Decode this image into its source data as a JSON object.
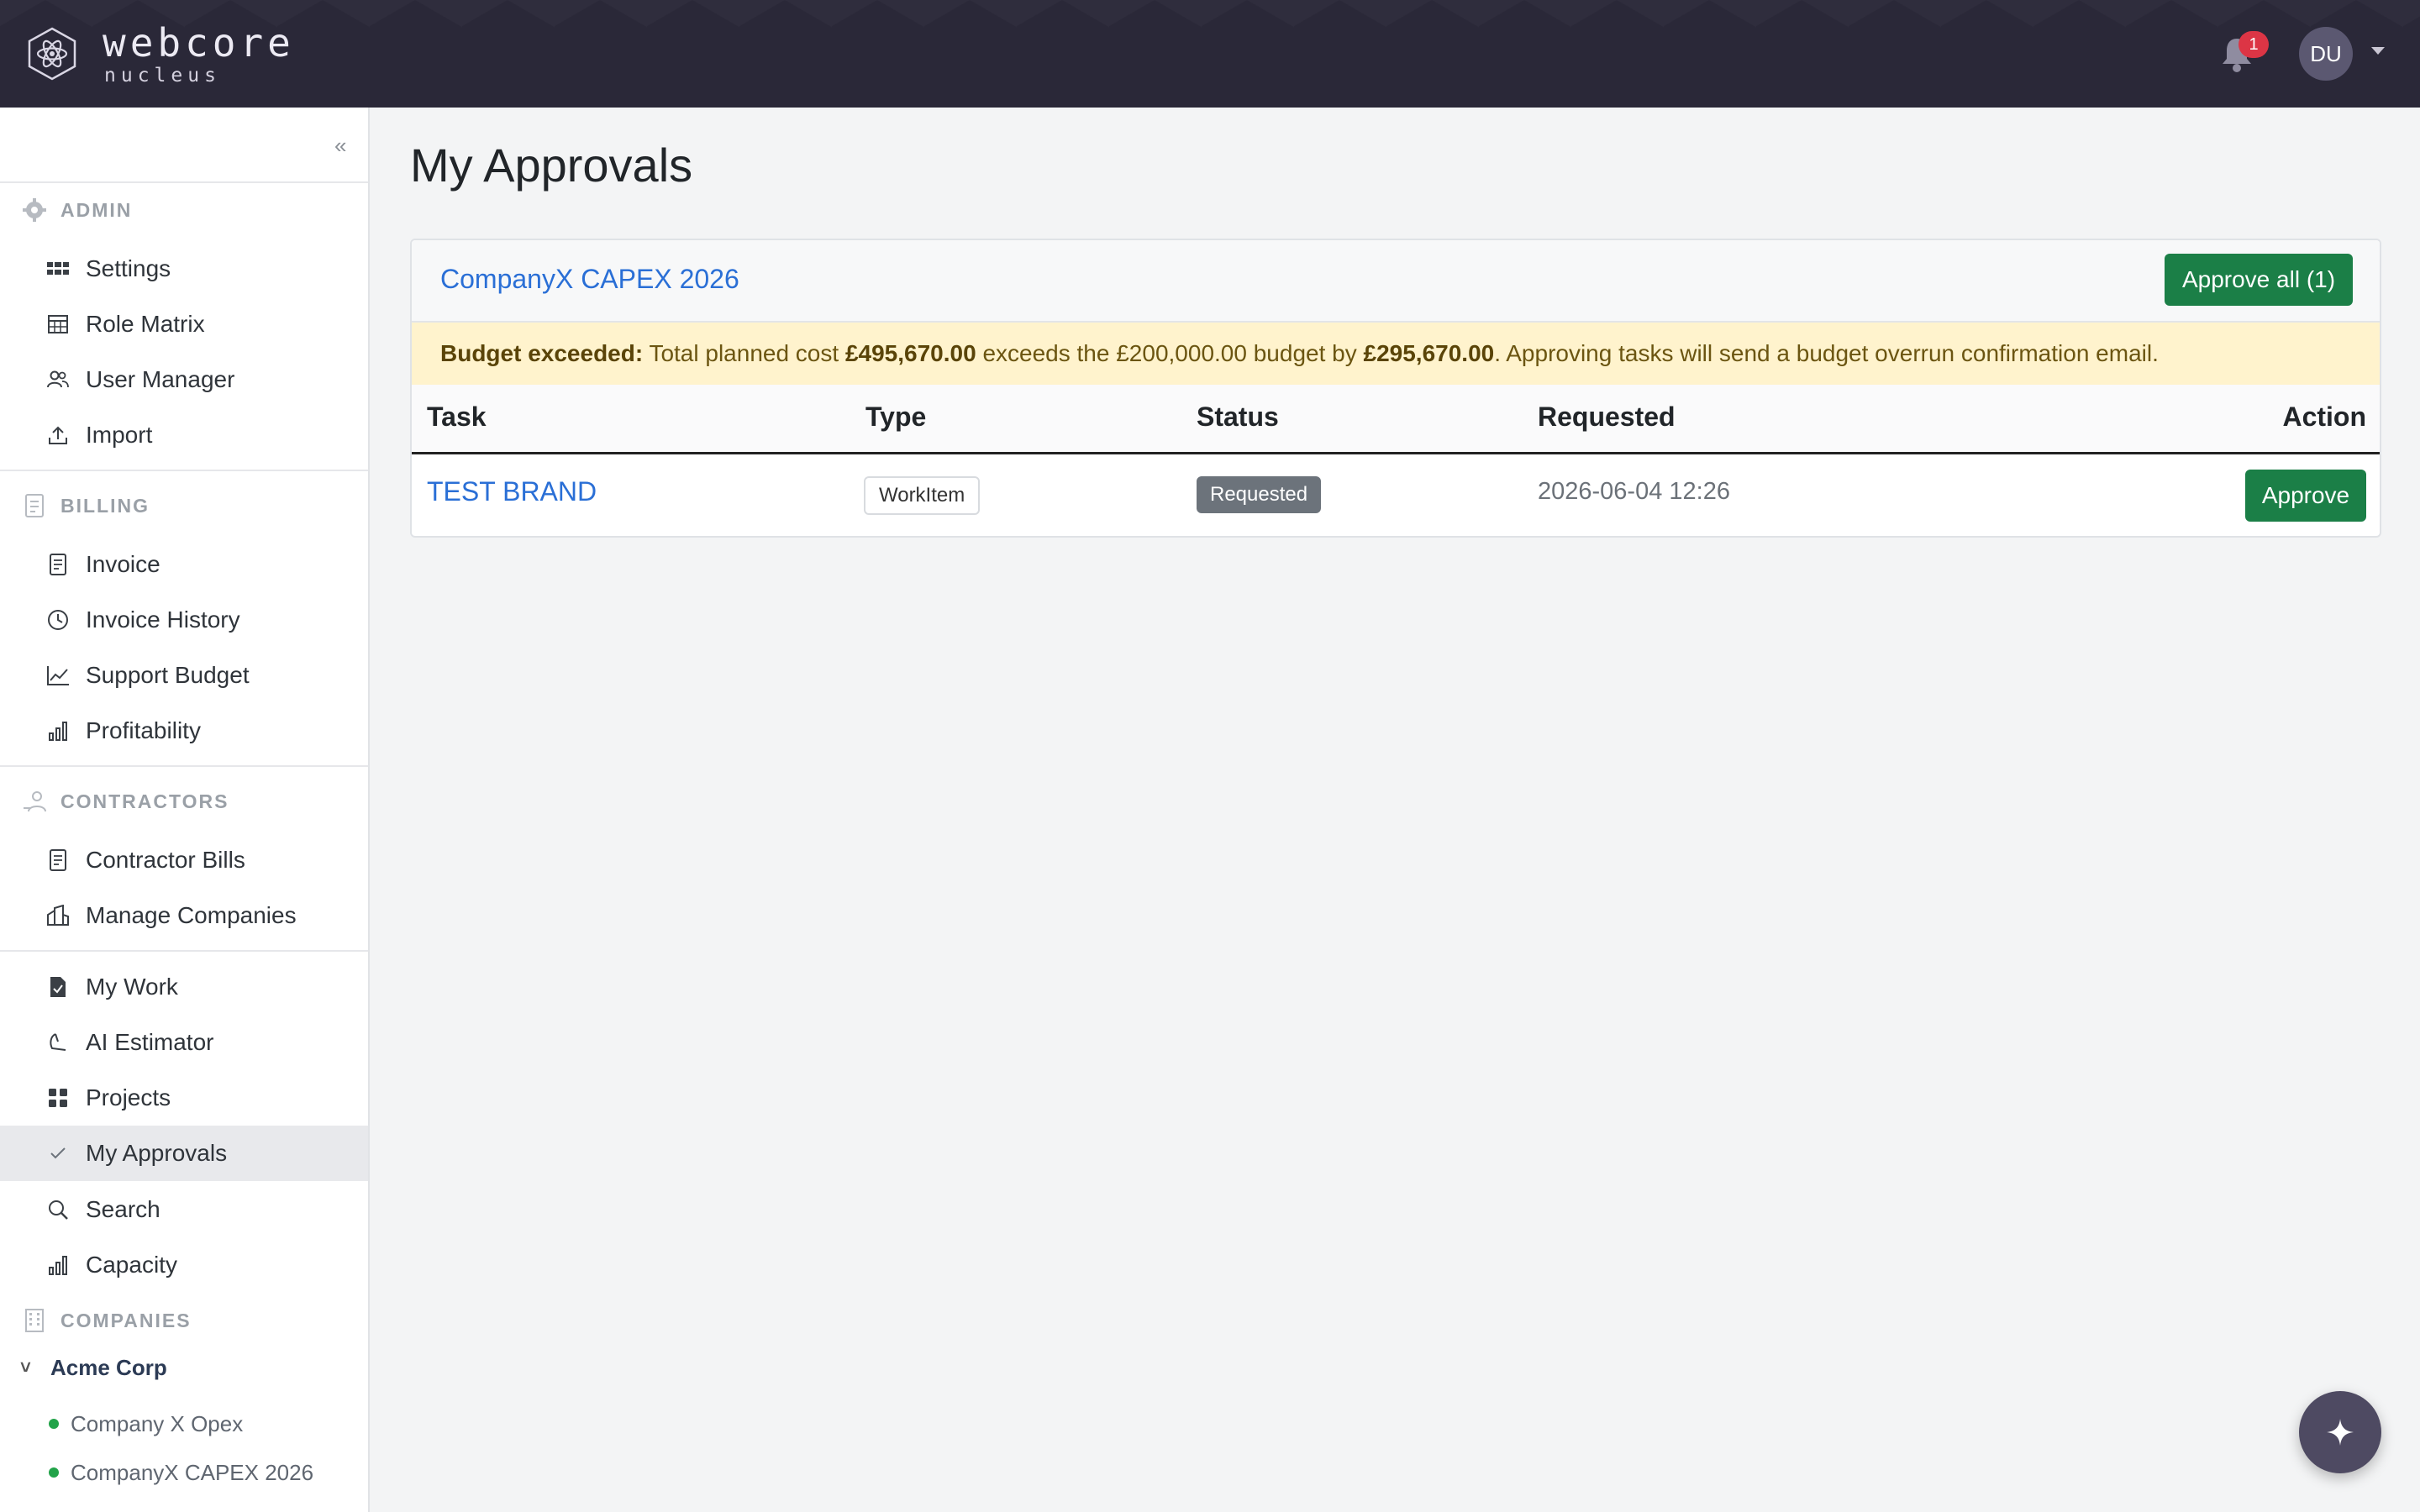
{
  "brand": {
    "name": "webcore",
    "sub": "nucleus"
  },
  "header": {
    "notification_count": "1",
    "user_initials": "DU"
  },
  "sidebar": {
    "collapse_label": "«",
    "sections": {
      "admin": "ADMIN",
      "billing": "BILLING",
      "contractors": "CONTRACTORS",
      "companies": "COMPANIES"
    },
    "items": {
      "settings": "Settings",
      "role_matrix": "Role Matrix",
      "user_manager": "User Manager",
      "import": "Import",
      "invoice": "Invoice",
      "invoice_history": "Invoice History",
      "support_budget": "Support Budget",
      "profitability": "Profitability",
      "contractor_bills": "Contractor Bills",
      "manage_companies": "Manage Companies",
      "my_work": "My Work",
      "ai_estimator": "AI Estimator",
      "projects": "Projects",
      "my_approvals": "My Approvals",
      "search": "Search",
      "capacity": "Capacity"
    },
    "company": "Acme Corp",
    "company_projects": [
      "Company X Opex",
      "CompanyX CAPEX 2026"
    ]
  },
  "main": {
    "title": "My Approvals",
    "card": {
      "project": "CompanyX CAPEX 2026",
      "approve_all": "Approve all (1)",
      "alert": {
        "label": "Budget exceeded:",
        "t1": "Total planned cost",
        "planned": "£495,670.00",
        "t2": "exceeds the",
        "budget": "£200,000.00",
        "t3": "budget by",
        "overrun": "£295,670.00",
        "t4": ". Approving tasks will send a budget overrun confirmation email."
      },
      "columns": [
        "Task",
        "Type",
        "Status",
        "Requested",
        "Action"
      ],
      "rows": [
        {
          "task": "TEST BRAND",
          "type": "WorkItem",
          "status": "Requested",
          "requested": "2026-06-04 12:26",
          "action": "Approve"
        }
      ]
    }
  },
  "colors": {
    "accent": "#2a6fd6",
    "success": "#1b7f47",
    "topbar": "#2a2838",
    "warning_bg": "#fff3cd"
  },
  "icons": [
    "atom-logo-icon",
    "bell-icon",
    "gear-icon",
    "document-icon",
    "users-icon",
    "building-icon",
    "sparkle-icon"
  ]
}
